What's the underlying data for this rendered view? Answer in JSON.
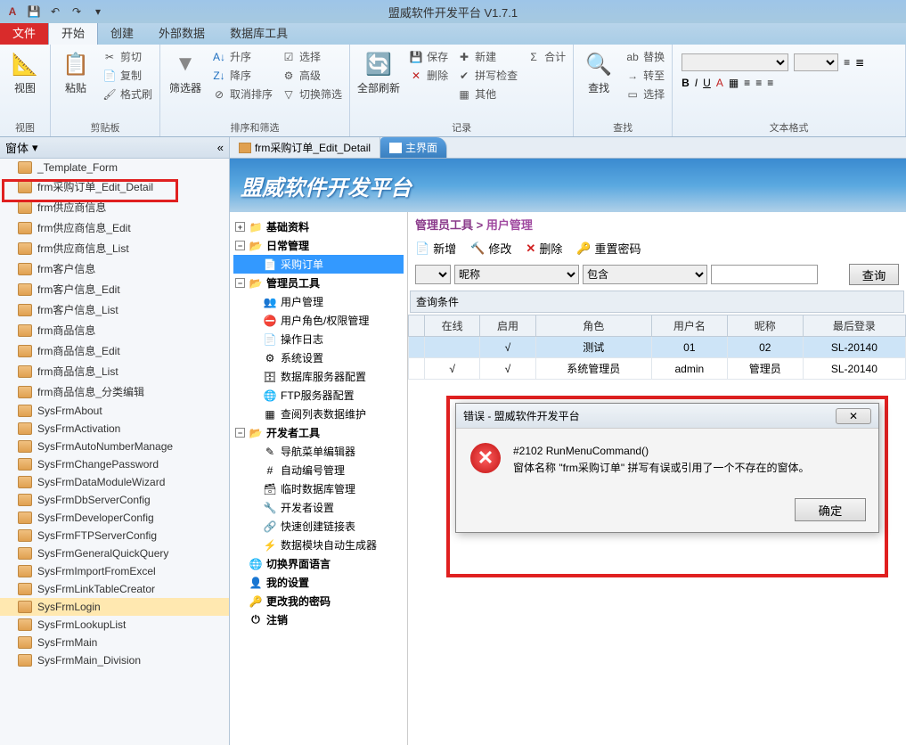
{
  "app": {
    "title": "盟威软件开发平台 V1.7.1"
  },
  "ribbonTabs": {
    "file": "文件",
    "tabs": [
      "开始",
      "创建",
      "外部数据",
      "数据库工具"
    ],
    "active": 0
  },
  "ribbon": {
    "view": "视图",
    "paste": "粘贴",
    "cut": "剪切",
    "copy": "复制",
    "formatPainter": "格式刷",
    "clipboard": "剪贴板",
    "filter": "筛选器",
    "asc": "升序",
    "desc": "降序",
    "clearSort": "取消排序",
    "select": "选择",
    "advanced": "高级",
    "toggleFilter": "切换筛选",
    "sortFilter": "排序和筛选",
    "refreshAll": "全部刷新",
    "saveRec": "保存",
    "new": "新建",
    "totals": "合计",
    "delete": "删除",
    "spell": "拼写检查",
    "more": "其他",
    "records": "记录",
    "find": "查找",
    "replace": "替换",
    "goto": "转至",
    "selectObj": "选择",
    "findGroup": "查找",
    "textFormat": "文本格式"
  },
  "nav": {
    "title": "窗体",
    "items": [
      "_Template_Form",
      "frm采购订单_Edit_Detail",
      "frm供应商信息",
      "frm供应商信息_Edit",
      "frm供应商信息_List",
      "frm客户信息",
      "frm客户信息_Edit",
      "frm客户信息_List",
      "frm商品信息",
      "frm商品信息_Edit",
      "frm商品信息_List",
      "frm商品信息_分类编辑",
      "SysFrmAbout",
      "SysFrmActivation",
      "SysFrmAutoNumberManage",
      "SysFrmChangePassword",
      "SysFrmDataModuleWizard",
      "SysFrmDbServerConfig",
      "SysFrmDeveloperConfig",
      "SysFrmFTPServerConfig",
      "SysFrmGeneralQuickQuery",
      "SysFrmImportFromExcel",
      "SysFrmLinkTableCreator",
      "SysFrmLogin",
      "SysFrmLookupList",
      "SysFrmMain",
      "SysFrmMain_Division"
    ],
    "highlighted": "SysFrmLogin"
  },
  "docTabs": {
    "tabs": [
      "frm采购订单_Edit_Detail",
      "主界面"
    ],
    "active": 1
  },
  "banner": "盟威软件开发平台",
  "tree": {
    "n1": "基础资料",
    "n2": "日常管理",
    "n2a": "采购订单",
    "n3": "管理员工具",
    "n3a": "用户管理",
    "n3b": "用户角色/权限管理",
    "n3c": "操作日志",
    "n3d": "系统设置",
    "n3e": "数据库服务器配置",
    "n3f": "FTP服务器配置",
    "n3g": "查阅列表数据维护",
    "n4": "开发者工具",
    "n4a": "导航菜单编辑器",
    "n4b": "自动编号管理",
    "n4c": "临时数据库管理",
    "n4d": "开发者设置",
    "n4e": "快速创建链接表",
    "n4f": "数据模块自动生成器",
    "n5": "切换界面语言",
    "n6": "我的设置",
    "n7": "更改我的密码",
    "n8": "注销"
  },
  "content": {
    "crumb1": "管理员工具",
    "crumb2": "用户管理",
    "btnNew": "新增",
    "btnEdit": "修改",
    "btnDel": "删除",
    "btnReset": "重置密码",
    "fField": "昵称",
    "fOp": "包含",
    "btnQuery": "查询",
    "qTitle": "查询条件"
  },
  "grid": {
    "cols": [
      "在线",
      "启用",
      "角色",
      "用户名",
      "昵称",
      "最后登录"
    ],
    "rows": [
      {
        "online": "",
        "enabled": "√",
        "role": "测试",
        "user": "01",
        "nick": "02",
        "last": "SL-20140"
      },
      {
        "online": "√",
        "enabled": "√",
        "role": "系统管理员",
        "user": "admin",
        "nick": "管理员",
        "last": "SL-20140"
      }
    ]
  },
  "dialog": {
    "title": "错误 - 盟威软件开发平台",
    "line1": "#2102 RunMenuCommand()",
    "line2": "窗体名称 \"frm采购订单\" 拼写有误或引用了一个不存在的窗体。",
    "ok": "确定"
  }
}
